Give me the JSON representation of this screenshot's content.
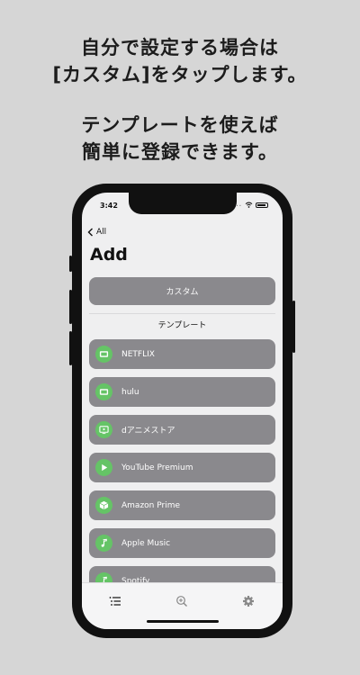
{
  "caption": {
    "line1": "自分で設定する場合は",
    "line2": "[カスタム]をタップします。",
    "line3": "テンプレートを使えば",
    "line4": "簡単に登録できます。"
  },
  "status_bar": {
    "time": "3:42",
    "signal": "...."
  },
  "nav": {
    "back_label": "All",
    "title": "Add"
  },
  "custom_button": {
    "label": "カスタム"
  },
  "template_section": {
    "label": "テンプレート"
  },
  "templates": [
    {
      "label": "NETFLIX",
      "icon": "tv-icon"
    },
    {
      "label": "hulu",
      "icon": "tv-icon"
    },
    {
      "label": "dアニメストア",
      "icon": "video-icon"
    },
    {
      "label": "YouTube Premium",
      "icon": "play-icon"
    },
    {
      "label": "Amazon Prime",
      "icon": "box-icon"
    },
    {
      "label": "Apple Music",
      "icon": "music-note-icon"
    },
    {
      "label": "Spotify",
      "icon": "music-note-icon"
    }
  ],
  "colors": {
    "background": "#d6d6d6",
    "row_background": "#8a898d",
    "icon_green": "#65c466"
  },
  "tabbar": {
    "tabs": [
      {
        "icon": "list-icon"
      },
      {
        "icon": "zoom-icon"
      },
      {
        "icon": "gear-icon"
      }
    ]
  }
}
